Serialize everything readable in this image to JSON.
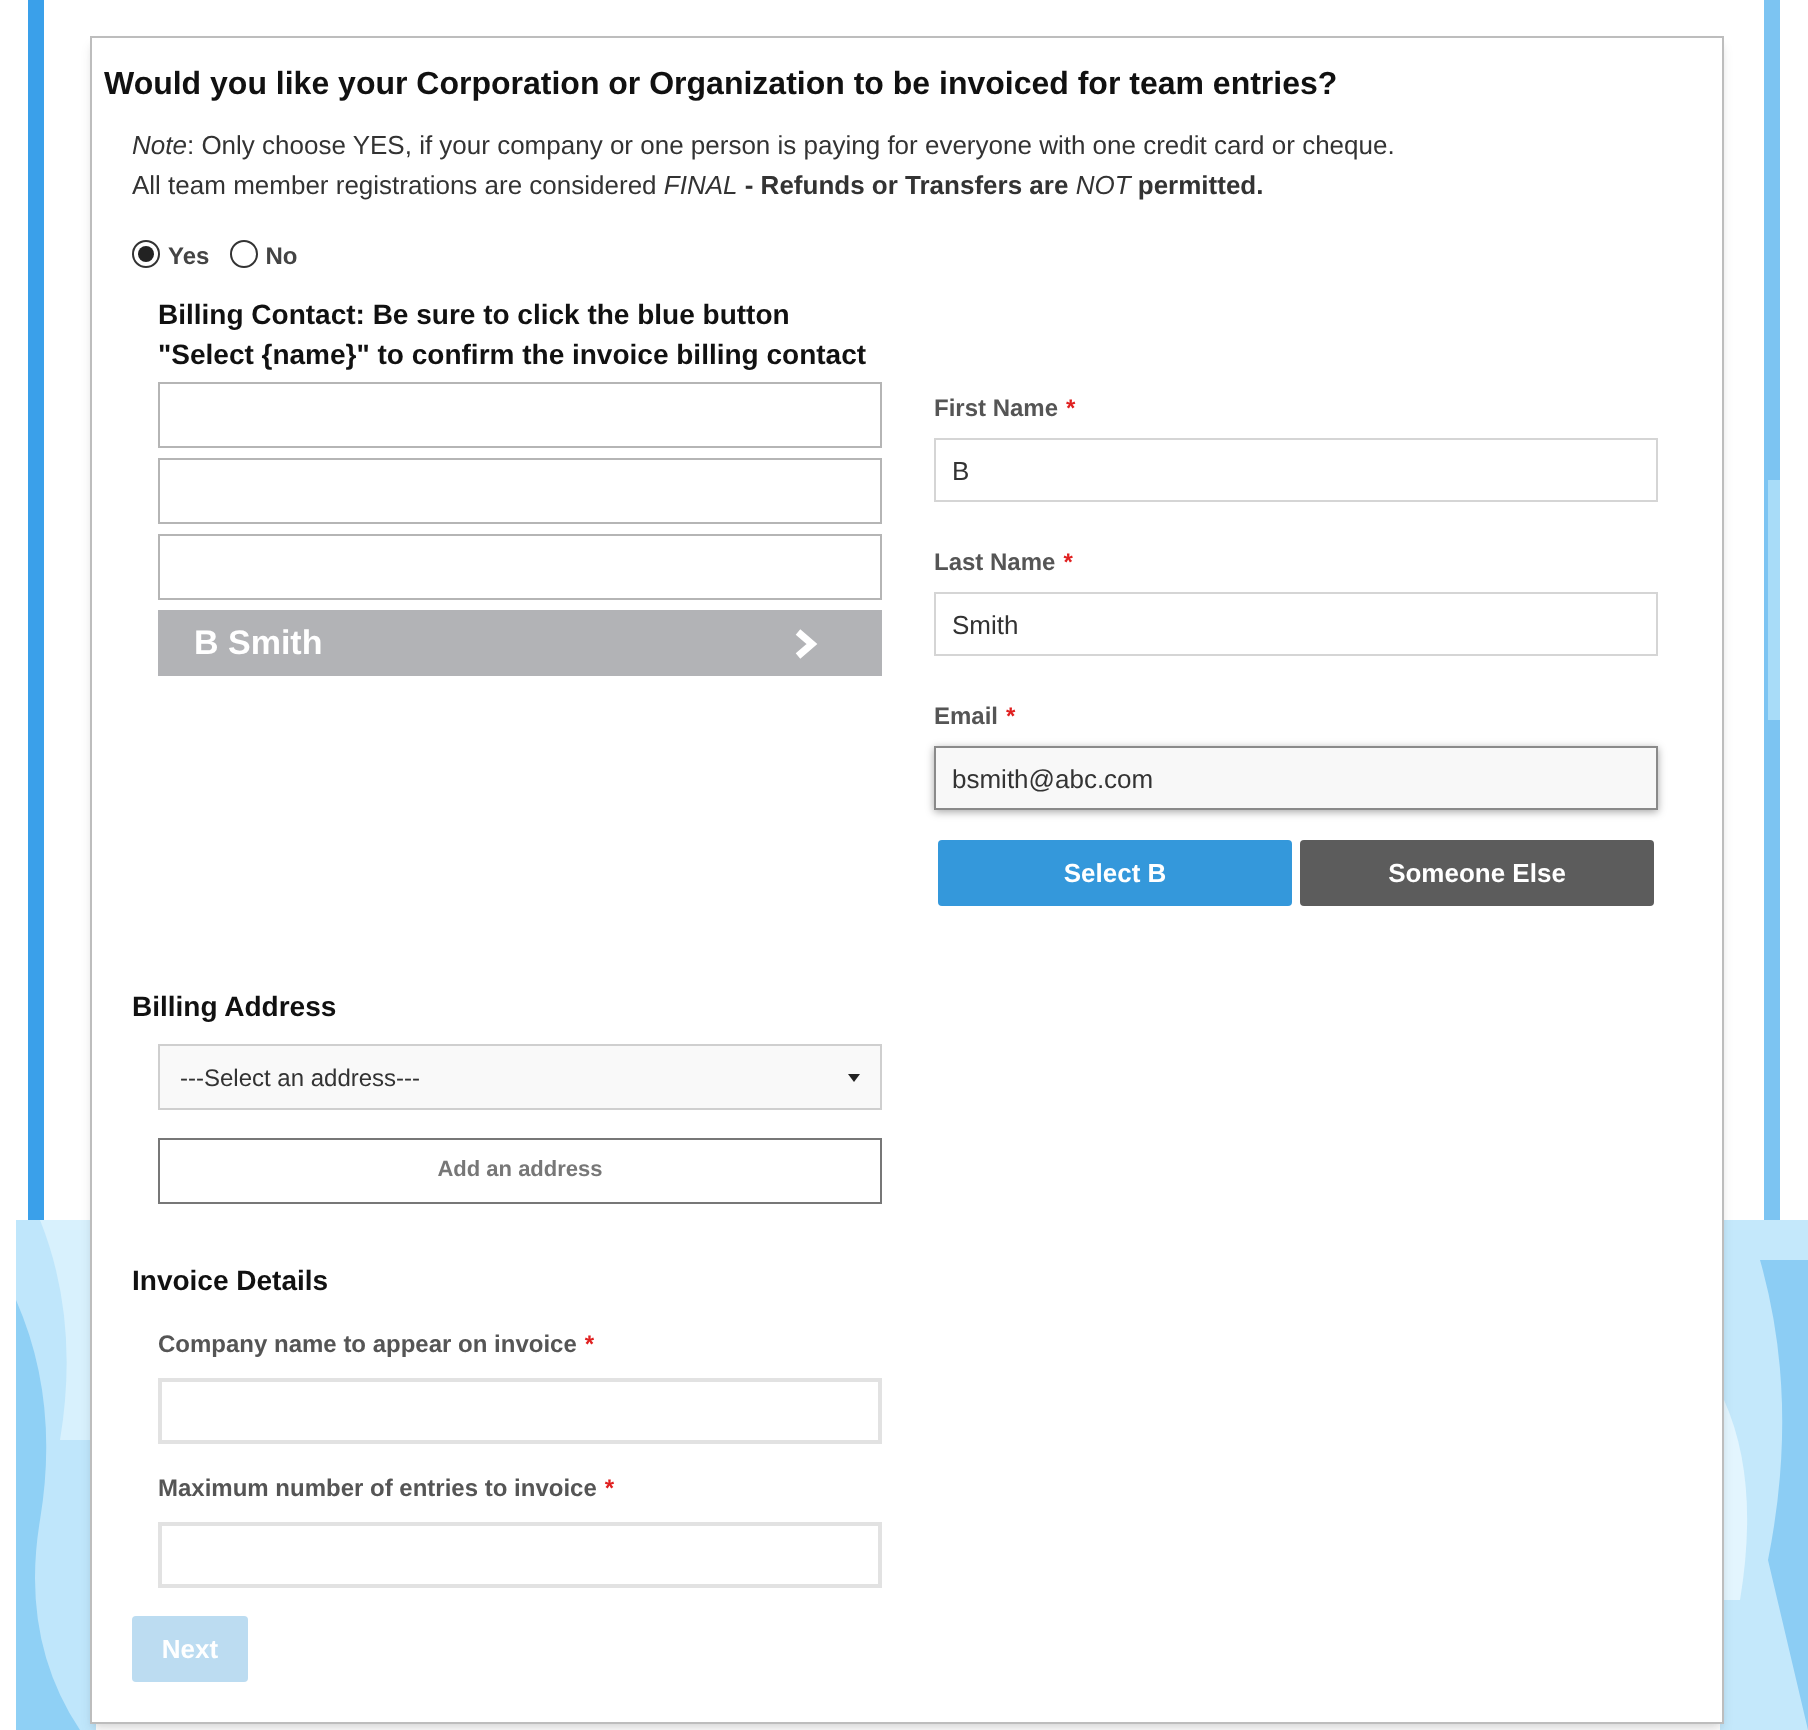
{
  "question": {
    "title": "Would you like your Corporation or Organization to be invoiced for team entries?",
    "note": "*Note*: Only choose YES, if your company or one person is paying for everyone with one credit card or cheque.",
    "warning": "All team member registrations are considered *FINAL* **- Refunds or Transfers are** *NOT* **permitted.**"
  },
  "options": [
    {
      "label": "Yes",
      "selected": true
    },
    {
      "label": "No",
      "selected": false
    }
  ],
  "billing_contact": {
    "instruction_lines": [
      "Billing Contact: Be sure to click the blue button",
      "\"Select {name}\" to confirm the invoice billing contact"
    ],
    "contacts": [
      {
        "kind": "empty"
      },
      {
        "kind": "empty"
      },
      {
        "kind": "empty"
      },
      {
        "kind": "person",
        "name": "B Smith"
      }
    ]
  },
  "contact_form": {
    "fields": [
      {
        "label": "First Name",
        "required_mark": "*",
        "value": "B",
        "focused": false
      },
      {
        "label": "Last Name",
        "required_mark": "*",
        "value": "Smith",
        "focused": false
      },
      {
        "label": "Email",
        "required_mark": "*",
        "value": "bsmith@abc.com",
        "focused": true
      }
    ],
    "buttons": [
      {
        "label": "Select B",
        "kind": "primary"
      },
      {
        "label": "Someone Else",
        "kind": "secondary"
      }
    ]
  },
  "billing_address": {
    "title": "Billing Address",
    "select": {
      "value": "---Select an address---"
    },
    "add_button": "Add an address"
  },
  "invoice_details": {
    "title": "Invoice Details",
    "fields": [
      {
        "label": "Company name to appear on invoice",
        "required_mark": "*"
      },
      {
        "label": "Maximum number of entries to invoice",
        "required_mark": "*"
      }
    ]
  },
  "next_button": {
    "label": "Next",
    "disabled": true
  }
}
